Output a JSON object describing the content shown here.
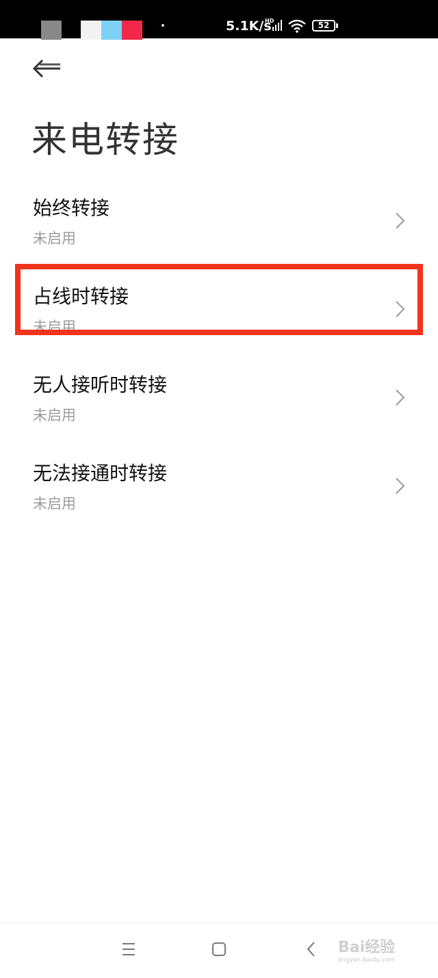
{
  "status_bar": {
    "net_speed": "5.1K/s",
    "hd_label": "HD",
    "battery_level": "52",
    "signal_icon": "signal-icon",
    "wifi_icon": "wifi-icon"
  },
  "header": {
    "back_icon": "back-arrow-icon",
    "title": "来电转接"
  },
  "items": [
    {
      "title": "始终转接",
      "subtitle": "未启用"
    },
    {
      "title": "占线时转接",
      "subtitle": "未启用"
    },
    {
      "title": "无人接听时转接",
      "subtitle": "未启用"
    },
    {
      "title": "无法接通时转接",
      "subtitle": "未启用"
    }
  ],
  "highlight_color": "#f0341d",
  "nav_bar": {
    "menu_icon": "menu-icon",
    "home_icon": "home-icon",
    "back_icon": "nav-back-icon"
  },
  "watermark": {
    "text": "Bai经验",
    "url": "jingyan.baidu.com"
  }
}
